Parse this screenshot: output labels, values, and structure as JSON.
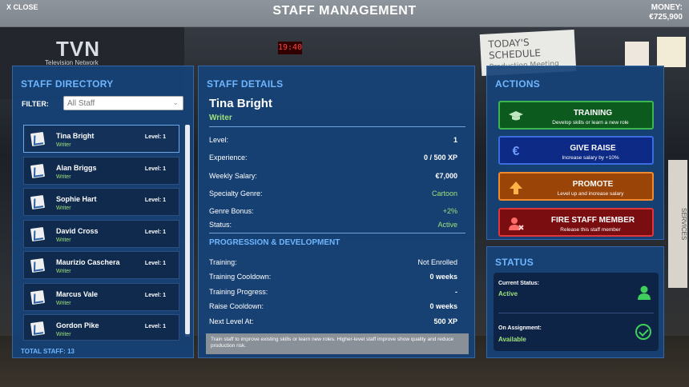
{
  "topbar": {
    "close_label": "X CLOSE",
    "title": "STAFF MANAGEMENT",
    "money_label": "MONEY:",
    "money_value": "€725,900"
  },
  "background": {
    "logo": "TVN",
    "logo_sub": "Television Network",
    "clock": "19:40",
    "schedule_title": "TODAY'S SCHEDULE",
    "schedule_sub": "Production Meeting",
    "poster": "SERVICES"
  },
  "directory": {
    "title": "STAFF DIRECTORY",
    "filter_label": "FILTER:",
    "filter_value": "All Staff",
    "total_label": "TOTAL STAFF: 13",
    "staff": [
      {
        "name": "Tina Bright",
        "role": "Writer",
        "level": "Level: 1"
      },
      {
        "name": "Alan Briggs",
        "role": "Writer",
        "level": "Level: 1"
      },
      {
        "name": "Sophie Hart",
        "role": "Writer",
        "level": "Level: 1"
      },
      {
        "name": "David Cross",
        "role": "Writer",
        "level": "Level: 1"
      },
      {
        "name": "Maurizio Caschera",
        "role": "Writer",
        "level": "Level: 1"
      },
      {
        "name": "Marcus Vale",
        "role": "Writer",
        "level": "Level: 1"
      },
      {
        "name": "Gordon Pike",
        "role": "Writer",
        "level": "Level: 1"
      }
    ]
  },
  "details": {
    "title": "STAFF DETAILS",
    "name": "Tina Bright",
    "role": "Writer",
    "rows": [
      {
        "label": "Level:",
        "value": "1"
      },
      {
        "label": "Experience:",
        "value": "0 / 500 XP"
      },
      {
        "label": "Weekly Salary:",
        "value": "€7,000"
      },
      {
        "label": "Specialty Genre:",
        "value": "Cartoon"
      },
      {
        "label": "Genre Bonus:",
        "value": "+2%"
      },
      {
        "label": "Status:",
        "value": "Active"
      }
    ],
    "progression_title": "PROGRESSION & DEVELOPMENT",
    "progression": [
      {
        "label": "Training:",
        "value": "Not Enrolled"
      },
      {
        "label": "Training Cooldown:",
        "value": "0 weeks"
      },
      {
        "label": "Training Progress:",
        "value": "-"
      },
      {
        "label": "Raise Cooldown:",
        "value": "0 weeks"
      },
      {
        "label": "Next Level At:",
        "value": "500 XP"
      }
    ],
    "hint": "Train staff to improve existing skills or learn new roles. Higher-level staff improve show quality and reduce production risk."
  },
  "actions": {
    "title": "ACTIONS",
    "training": {
      "label": "TRAINING",
      "desc": "Develop skills or learn a new role"
    },
    "raise": {
      "label": "GIVE RAISE",
      "desc": "Increase salary by +10%"
    },
    "promote": {
      "label": "PROMOTE",
      "desc": "Level up and increase salary"
    },
    "fire": {
      "label": "FIRE STAFF MEMBER",
      "desc": "Release this staff member"
    }
  },
  "status": {
    "title": "STATUS",
    "current_label": "Current Status:",
    "current_value": "Active",
    "assignment_label": "On Assignment:",
    "assignment_value": "Available"
  },
  "colors": {
    "accent_blue": "#6fb6ff",
    "green_text": "#9fe27a",
    "training": "#0d5a1f",
    "raise": "#0d2a86",
    "promote": "#9a4408",
    "fire": "#7a0d10"
  }
}
